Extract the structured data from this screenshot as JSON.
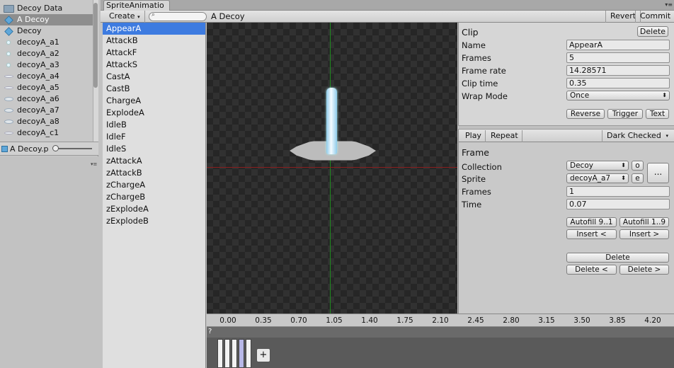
{
  "project": {
    "items": [
      {
        "label": "Decoy Data",
        "icon": "folder-icon",
        "selected": false
      },
      {
        "label": "A Decoy",
        "icon": "prefab-cube-icon",
        "selected": true
      },
      {
        "label": "Decoy",
        "icon": "prefab-cube-icon",
        "selected": false
      },
      {
        "label": "decoyA_a1",
        "icon": "sprite-dot-icon",
        "selected": false
      },
      {
        "label": "decoyA_a2",
        "icon": "sprite-dot-icon",
        "selected": false
      },
      {
        "label": "decoyA_a3",
        "icon": "sprite-dot-icon",
        "selected": false
      },
      {
        "label": "decoyA_a4",
        "icon": "sprite-ellipse-icon",
        "selected": false
      },
      {
        "label": "decoyA_a5",
        "icon": "sprite-ellipse-icon",
        "selected": false
      },
      {
        "label": "decoyA_a6",
        "icon": "sprite-beam-icon",
        "selected": false
      },
      {
        "label": "decoyA_a7",
        "icon": "sprite-beam-icon",
        "selected": false
      },
      {
        "label": "decoyA_a8",
        "icon": "sprite-beam-icon",
        "selected": false
      },
      {
        "label": "decoyA_c1",
        "icon": "sprite-ellipse-icon",
        "selected": false
      }
    ],
    "bottom_selected": "A Decoy.p"
  },
  "tab": {
    "title": "SpriteAnimatio"
  },
  "toolbar": {
    "create_label": "Create",
    "document_title": "A Decoy",
    "revert_label": "Revert",
    "commit_label": "Commit"
  },
  "clips": [
    {
      "label": "AppearA",
      "selected": true
    },
    {
      "label": "AttackB"
    },
    {
      "label": "AttackF"
    },
    {
      "label": "AttackS"
    },
    {
      "label": "CastA"
    },
    {
      "label": "CastB"
    },
    {
      "label": "ChargeA"
    },
    {
      "label": "ExplodeA"
    },
    {
      "label": "IdleB"
    },
    {
      "label": "IdleF"
    },
    {
      "label": "IdleS"
    },
    {
      "label": "zAttackA"
    },
    {
      "label": "zAttackB"
    },
    {
      "label": "zChargeA"
    },
    {
      "label": "zChargeB"
    },
    {
      "label": "zExplodeA"
    },
    {
      "label": "zExplodeB"
    }
  ],
  "clip": {
    "header": "Clip",
    "delete_label": "Delete",
    "name_label": "Name",
    "name_value": "AppearA",
    "frames_label": "Frames",
    "frames_value": "5",
    "framerate_label": "Frame rate",
    "framerate_value": "14.28571",
    "cliptime_label": "Clip time",
    "cliptime_value": "0.35",
    "wrapmode_label": "Wrap Mode",
    "wrapmode_value": "Once",
    "reverse_label": "Reverse",
    "trigger_label": "Trigger",
    "text_label": "Text"
  },
  "playbar": {
    "play_label": "Play",
    "repeat_label": "Repeat",
    "background_value": "Dark Checked"
  },
  "frame": {
    "header": "Frame",
    "collection_label": "Collection",
    "collection_value": "Decoy",
    "sprite_label": "Sprite",
    "sprite_value": "decoyA_a7",
    "frames_label": "Frames",
    "frames_value": "1",
    "time_label": "Time",
    "time_value": "0.07",
    "o_label": "o",
    "e_label": "e",
    "more_label": "...",
    "autofill_a_label": "Autofill 9..1",
    "autofill_b_label": "Autofill 1..9",
    "insert_before_label": "Insert <",
    "insert_after_label": "Insert >",
    "delete_label": "Delete",
    "delete_before_label": "Delete <",
    "delete_after_label": "Delete >"
  },
  "timeline": {
    "ticks": [
      "0.00",
      "0.35",
      "0.70",
      "1.05",
      "1.40",
      "1.75",
      "2.10",
      "2.45",
      "2.80",
      "3.15",
      "3.50",
      "3.85",
      "4.20"
    ],
    "help_label": "?",
    "add_label": "+",
    "frame_count": 5,
    "selected_frame": 4
  }
}
